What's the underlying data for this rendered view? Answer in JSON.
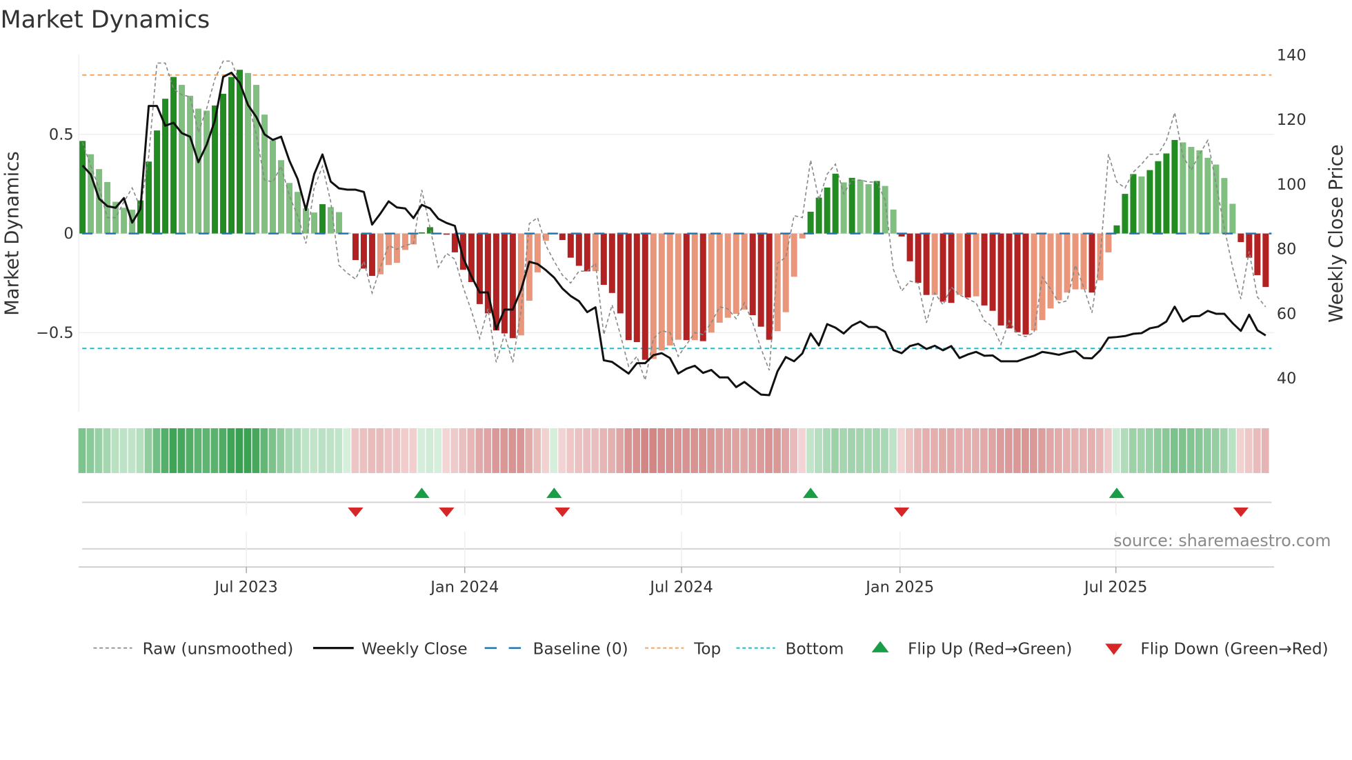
{
  "chart_data": {
    "type": "bar",
    "title": "Market Dynamics",
    "ylabel": "Market Dynamics",
    "y2label": "Weekly Close Price",
    "ylim": [
      -0.9,
      0.9
    ],
    "y2lim": [
      30,
      140
    ],
    "yticks": [
      {
        "v": 0.5,
        "label": "0.5"
      },
      {
        "v": 0,
        "label": "0"
      },
      {
        "v": -0.5,
        "label": "−0.5"
      }
    ],
    "y2ticks": [
      {
        "v": 140,
        "label": "140"
      },
      {
        "v": 120,
        "label": "120"
      },
      {
        "v": 100,
        "label": "100"
      },
      {
        "v": 80,
        "label": "80"
      },
      {
        "v": 60,
        "label": "60"
      },
      {
        "v": 40,
        "label": "40"
      }
    ],
    "xticks": [
      {
        "week": 20.8,
        "label": "Jul 2023"
      },
      {
        "week": 47.2,
        "label": "Jan 2024"
      },
      {
        "week": 73.4,
        "label": "Jul 2024"
      },
      {
        "week": 99.8,
        "label": "Jan 2025"
      },
      {
        "week": 125.9,
        "label": "Jul 2025"
      }
    ],
    "top_level": 0.8,
    "bottom_level": -0.58,
    "baseline": 0,
    "series": [
      {
        "name": "Market Dynamics",
        "values": [
          0.467,
          0.4,
          0.325,
          0.26,
          0.16,
          0.13,
          0.12,
          0.167,
          0.363,
          0.52,
          0.68,
          0.79,
          0.75,
          0.695,
          0.63,
          0.62,
          0.646,
          0.705,
          0.79,
          0.826,
          0.81,
          0.75,
          0.6,
          0.47,
          0.37,
          0.255,
          0.21,
          0.127,
          0.106,
          0.148,
          0.133,
          0.108,
          0.004,
          -0.134,
          -0.177,
          -0.214,
          -0.206,
          -0.159,
          -0.148,
          -0.083,
          -0.055,
          0.006,
          0.032,
          0.002,
          -0.006,
          -0.095,
          -0.183,
          -0.245,
          -0.356,
          -0.403,
          -0.489,
          -0.504,
          -0.528,
          -0.514,
          -0.339,
          -0.196,
          -0.036,
          0.003,
          -0.033,
          -0.122,
          -0.163,
          -0.191,
          -0.19,
          -0.259,
          -0.3,
          -0.403,
          -0.538,
          -0.548,
          -0.637,
          -0.633,
          -0.59,
          -0.565,
          -0.536,
          -0.538,
          -0.538,
          -0.543,
          -0.5,
          -0.45,
          -0.425,
          -0.405,
          -0.384,
          -0.412,
          -0.47,
          -0.536,
          -0.493,
          -0.397,
          -0.218,
          -0.025,
          0.11,
          0.181,
          0.232,
          0.302,
          0.258,
          0.281,
          0.271,
          0.249,
          0.265,
          0.24,
          0.121,
          -0.015,
          -0.14,
          -0.249,
          -0.31,
          -0.31,
          -0.344,
          -0.35,
          -0.31,
          -0.323,
          -0.317,
          -0.363,
          -0.39,
          -0.464,
          -0.479,
          -0.498,
          -0.51,
          -0.489,
          -0.437,
          -0.378,
          -0.337,
          -0.298,
          -0.282,
          -0.282,
          -0.298,
          -0.236,
          -0.095,
          0.041,
          0.2,
          0.3,
          0.288,
          0.32,
          0.365,
          0.404,
          0.472,
          0.46,
          0.437,
          0.42,
          0.382,
          0.348,
          0.28,
          0.15,
          -0.043,
          -0.122,
          -0.21,
          -0.27
        ],
        "strengthening": [
          1,
          0,
          0,
          0,
          0,
          0,
          0,
          1,
          1,
          1,
          1,
          1,
          0,
          0,
          0,
          0,
          1,
          1,
          1,
          1,
          0,
          0,
          0,
          0,
          0,
          0,
          0,
          0,
          0,
          1,
          0,
          0,
          0,
          1,
          1,
          1,
          0,
          0,
          0,
          0,
          0,
          1,
          1,
          0,
          1,
          1,
          1,
          1,
          1,
          1,
          1,
          1,
          1,
          0,
          0,
          0,
          0,
          0,
          1,
          1,
          1,
          1,
          0,
          1,
          1,
          1,
          1,
          1,
          1,
          0,
          0,
          0,
          0,
          1,
          0,
          1,
          0,
          0,
          0,
          0,
          0,
          1,
          1,
          1,
          0,
          0,
          0,
          0,
          1,
          1,
          1,
          1,
          0,
          1,
          0,
          0,
          1,
          0,
          0,
          1,
          1,
          1,
          1,
          0,
          1,
          1,
          0,
          1,
          0,
          1,
          1,
          1,
          1,
          1,
          1,
          0,
          0,
          0,
          0,
          0,
          0,
          0,
          1,
          0,
          0,
          1,
          1,
          1,
          0,
          1,
          1,
          1,
          1,
          0,
          0,
          0,
          0,
          0,
          0,
          0,
          1,
          1,
          1,
          1
        ]
      },
      {
        "name": "Raw (unsmoothed)",
        "values": [
          0.46,
          0.34,
          0.23,
          0.08,
          0.08,
          0.16,
          0.23,
          0.13,
          0.39,
          0.86,
          0.86,
          0.73,
          0.7,
          0.69,
          0.51,
          0.63,
          0.78,
          0.87,
          0.87,
          0.76,
          0.66,
          0.5,
          0.27,
          0.26,
          0.34,
          0.19,
          0.09,
          -0.05,
          0.23,
          0.34,
          0.16,
          -0.16,
          -0.2,
          -0.23,
          -0.14,
          -0.3,
          -0.17,
          -0.06,
          -0.08,
          -0.06,
          -0.05,
          0.22,
          0.03,
          -0.17,
          -0.1,
          -0.13,
          -0.27,
          -0.39,
          -0.53,
          -0.38,
          -0.65,
          -0.51,
          -0.65,
          -0.39,
          0.05,
          0.08,
          -0.06,
          -0.14,
          -0.21,
          -0.25,
          -0.19,
          -0.19,
          -0.15,
          -0.51,
          -0.36,
          -0.51,
          -0.67,
          -0.62,
          -0.74,
          -0.53,
          -0.49,
          -0.5,
          -0.62,
          -0.56,
          -0.5,
          -0.51,
          -0.45,
          -0.37,
          -0.38,
          -0.43,
          -0.35,
          -0.45,
          -0.58,
          -0.69,
          -0.15,
          -0.12,
          0.09,
          0.08,
          0.37,
          0.17,
          0.3,
          0.35,
          0.2,
          0.27,
          0.27,
          0.26,
          0.26,
          0.17,
          -0.18,
          -0.29,
          -0.24,
          -0.25,
          -0.45,
          -0.3,
          -0.36,
          -0.27,
          -0.31,
          -0.33,
          -0.35,
          -0.44,
          -0.47,
          -0.56,
          -0.44,
          -0.51,
          -0.52,
          -0.5,
          -0.22,
          -0.28,
          -0.35,
          -0.34,
          -0.16,
          -0.27,
          -0.4,
          -0.12,
          0.4,
          0.26,
          0.23,
          0.31,
          0.35,
          0.4,
          0.4,
          0.47,
          0.61,
          0.39,
          0.32,
          0.4,
          0.47,
          0.25,
          0.03,
          -0.17,
          -0.33,
          -0.09,
          -0.32,
          -0.37
        ]
      },
      {
        "name": "Weekly Close",
        "axis": "right",
        "values": [
          105.6,
          102.8,
          95.3,
          93,
          92.5,
          95.5,
          87.9,
          92.1,
          124,
          124,
          117.9,
          118.8,
          115.6,
          114.5,
          106.6,
          112,
          119.5,
          133,
          134.3,
          131.2,
          124.3,
          120.6,
          115.2,
          113.5,
          114.5,
          107.1,
          101.4,
          91.8,
          102.9,
          109,
          100.6,
          98.5,
          98.1,
          98.1,
          97.4,
          87.3,
          90.7,
          94.5,
          92.6,
          92.3,
          89.3,
          93.4,
          92.3,
          89.1,
          87.8,
          86.9,
          77,
          71.3,
          66.3,
          66.3,
          54.9,
          61,
          61,
          67.1,
          75.8,
          75.1,
          73.2,
          70.9,
          67.5,
          65.2,
          63.6,
          60.2,
          61.7,
          45.3,
          44.8,
          43,
          41.2,
          44.4,
          44.4,
          46.9,
          47.5,
          46,
          41.2,
          42.7,
          43.6,
          41.4,
          42.3,
          40,
          40,
          37,
          38.6,
          36.6,
          34.7,
          34.5,
          41.9,
          46.3,
          45,
          47.4,
          53.6,
          49.9,
          56.5,
          55.4,
          53.6,
          56,
          57.3,
          55.6,
          55.6,
          54.1,
          48.5,
          47.5,
          49.7,
          50.4,
          48.8,
          49.8,
          48.4,
          49.7,
          46,
          47.1,
          47.9,
          46.7,
          46.8,
          45,
          45,
          45,
          45.9,
          46.7,
          47.9,
          47.5,
          47,
          47.7,
          48.2,
          46,
          45.9,
          48.4,
          52.3,
          52.5,
          52.8,
          53.5,
          53.7,
          55.2,
          55.7,
          57.3,
          61.9,
          57.3,
          58.9,
          59,
          60.6,
          59.7,
          59.7,
          56.8,
          54.4,
          59.4,
          54.6,
          53
        ]
      }
    ],
    "flips_up_weeks": [
      42,
      58,
      89,
      126
    ],
    "flips_down_weeks": [
      34,
      45,
      59,
      100,
      141
    ],
    "legend": {
      "placement": "bottom",
      "items": [
        {
          "label": "Raw (unsmoothed)",
          "kind": "raw"
        },
        {
          "label": "Weekly Close",
          "kind": "close"
        },
        {
          "label": "Baseline (0)",
          "kind": "baseline"
        },
        {
          "label": "Top",
          "kind": "top"
        },
        {
          "label": "Bottom",
          "kind": "bottom"
        },
        {
          "label": "Flip Up (Red→Green)",
          "kind": "up"
        },
        {
          "label": "Flip Down (Green→Red)",
          "kind": "down"
        }
      ]
    },
    "annotation": "source: sharemaestro.com",
    "colors": {
      "strong_green": "#228b22",
      "weak_green": "#80bf80",
      "strong_red": "#b22222",
      "weak_red": "#e9967a",
      "close": "#111111",
      "raw": "#888888",
      "baseline": "#1f77b4",
      "top": "#f4a460",
      "bottom": "#17becf",
      "flip_up": "#1a9e45",
      "flip_down": "#d62728"
    }
  }
}
